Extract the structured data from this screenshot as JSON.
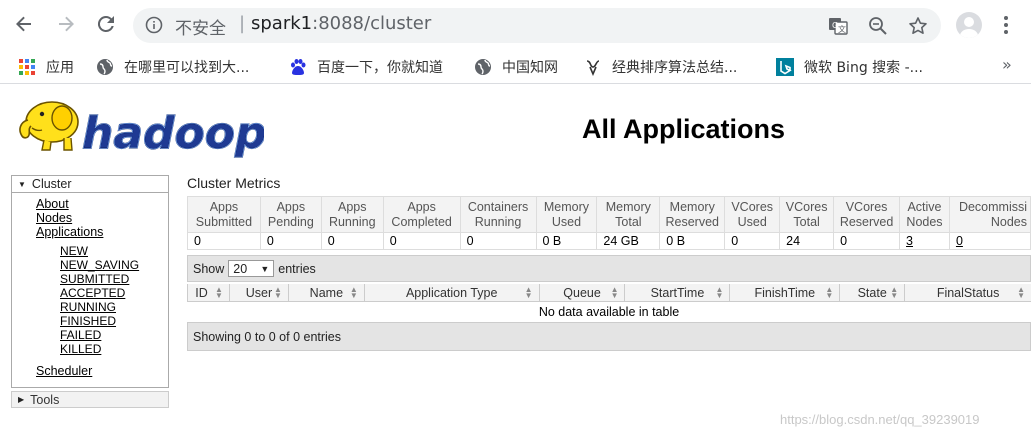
{
  "browser": {
    "insecure_label": "不安全",
    "separator": "|",
    "url_host": "spark1",
    "url_rest": ":8088/cluster",
    "bookmarks": [
      {
        "label": "应用",
        "icon": "apps-grid-icon"
      },
      {
        "label": "在哪里可以找到大...",
        "icon": "globe-icon"
      },
      {
        "label": "百度一下，你就知道",
        "icon": "baidu-paw-icon"
      },
      {
        "label": "中国知网",
        "icon": "globe-icon"
      },
      {
        "label": "经典排序算法总结...",
        "icon": "csdn-icon"
      },
      {
        "label": "微软 Bing 搜索 -...",
        "icon": "bing-icon"
      }
    ],
    "more": "»"
  },
  "page": {
    "title": "All Applications",
    "logo_text": "hadoop"
  },
  "sidebar": {
    "cluster_label": "Cluster",
    "links": [
      "About",
      "Nodes",
      "Applications"
    ],
    "app_states": [
      "NEW",
      "NEW_SAVING",
      "SUBMITTED",
      "ACCEPTED",
      "RUNNING",
      "FINISHED",
      "FAILED",
      "KILLED"
    ],
    "scheduler": "Scheduler",
    "tools_label": "Tools"
  },
  "metrics": {
    "title": "Cluster Metrics",
    "headers": [
      [
        "Apps",
        "Submitted"
      ],
      [
        "Apps",
        "Pending"
      ],
      [
        "Apps",
        "Running"
      ],
      [
        "Apps",
        "Completed"
      ],
      [
        "Containers",
        "Running"
      ],
      [
        "Memory",
        "Used"
      ],
      [
        "Memory",
        "Total"
      ],
      [
        "Memory",
        "Reserved"
      ],
      [
        "VCores",
        "Used"
      ],
      [
        "VCores",
        "Total"
      ],
      [
        "VCores",
        "Reserved"
      ],
      [
        "Active",
        "Nodes"
      ],
      [
        "Decommissi",
        "Nodes"
      ]
    ],
    "values": [
      "0",
      "0",
      "0",
      "0",
      "0",
      "0 B",
      "24 GB",
      "0 B",
      "0",
      "24",
      "0",
      "3",
      "0"
    ]
  },
  "apps_table": {
    "show_label": "Show",
    "page_size": "20",
    "entries_label": "entries",
    "columns": [
      "ID",
      "User",
      "Name",
      "Application Type",
      "Queue",
      "StartTime",
      "FinishTime",
      "State",
      "FinalStatus"
    ],
    "empty_message": "No data available in table",
    "summary": "Showing 0 to 0 of 0 entries"
  },
  "watermark": "https://blog.csdn.net/qq_39239019"
}
